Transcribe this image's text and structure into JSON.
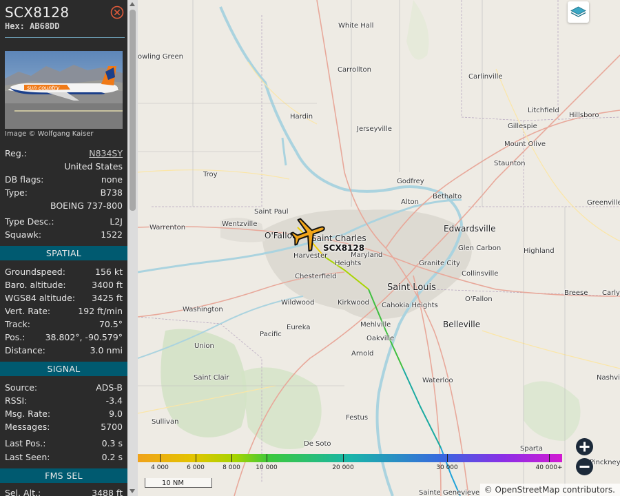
{
  "aircraft": {
    "callsign": "SCX8128",
    "hex_label": "Hex:",
    "hex": "AB68DD",
    "photo_credit": "Image © Wolfgang Kaiser"
  },
  "details": [
    {
      "key": "Reg.:",
      "value": "N834SY",
      "link": true
    },
    {
      "key": "",
      "value": "United States"
    },
    {
      "key": "DB flags:",
      "value": "none"
    },
    {
      "key": "Type:",
      "value": "B738"
    },
    {
      "key": "",
      "value": "BOEING 737-800"
    },
    {
      "key": "Type Desc.:",
      "value": "L2J"
    },
    {
      "key": "Squawk:",
      "value": "1522"
    }
  ],
  "spatial": {
    "title": "SPATIAL",
    "rows": [
      {
        "key": "Groundspeed:",
        "value": "156 kt"
      },
      {
        "key": "Baro. altitude:",
        "value": "3400 ft"
      },
      {
        "key": "WGS84 altitude:",
        "value": "3425 ft"
      },
      {
        "key": "Vert. Rate:",
        "value": "192 ft/min"
      },
      {
        "key": "Track:",
        "value": "70.5°"
      },
      {
        "key": "Pos.:",
        "value": "38.802°, -90.579°"
      },
      {
        "key": "Distance:",
        "value": "3.0 nmi"
      }
    ]
  },
  "signal": {
    "title": "SIGNAL",
    "rows": [
      {
        "key": "Source:",
        "value": "ADS-B"
      },
      {
        "key": "RSSI:",
        "value": "-3.4"
      },
      {
        "key": "Msg. Rate:",
        "value": "9.0"
      },
      {
        "key": "Messages:",
        "value": "5700"
      },
      {
        "key": "Last Pos.:",
        "value": "0.3 s"
      },
      {
        "key": "Last Seen:",
        "value": "0.2 s"
      }
    ]
  },
  "fms": {
    "title": "FMS SEL",
    "rows": [
      {
        "key": "Sel. Alt.:",
        "value": "3488 ft"
      }
    ]
  },
  "map": {
    "aircraft_label": "SCX8128",
    "places": [
      {
        "name": "White Hall",
        "cls": ""
      },
      {
        "name": "owling Green",
        "cls": ""
      },
      {
        "name": "Carrollton",
        "cls": ""
      },
      {
        "name": "Carlinville",
        "cls": ""
      },
      {
        "name": "Hardin",
        "cls": ""
      },
      {
        "name": "Litchfield",
        "cls": ""
      },
      {
        "name": "Hillsboro",
        "cls": ""
      },
      {
        "name": "Jerseyville",
        "cls": ""
      },
      {
        "name": "Gillespie",
        "cls": ""
      },
      {
        "name": "Mount Olive",
        "cls": ""
      },
      {
        "name": "Staunton",
        "cls": ""
      },
      {
        "name": "Troy",
        "cls": ""
      },
      {
        "name": "Godfrey",
        "cls": ""
      },
      {
        "name": "Bethalto",
        "cls": ""
      },
      {
        "name": "Alton",
        "cls": ""
      },
      {
        "name": "Greenville",
        "cls": ""
      },
      {
        "name": "Saint Paul",
        "cls": ""
      },
      {
        "name": "Wentzville",
        "cls": ""
      },
      {
        "name": "Warrenton",
        "cls": ""
      },
      {
        "name": "O'Fallon",
        "cls": "city"
      },
      {
        "name": "Saint Charles",
        "cls": "city"
      },
      {
        "name": "Edwardsville",
        "cls": "city"
      },
      {
        "name": "Maryland",
        "cls": ""
      },
      {
        "name": "Heights",
        "cls": ""
      },
      {
        "name": "Harvester",
        "cls": ""
      },
      {
        "name": "Glen Carbon",
        "cls": ""
      },
      {
        "name": "Highland",
        "cls": ""
      },
      {
        "name": "Granite City",
        "cls": ""
      },
      {
        "name": "Chesterfield",
        "cls": ""
      },
      {
        "name": "Collinsville",
        "cls": ""
      },
      {
        "name": "Saint Louis",
        "cls": "big"
      },
      {
        "name": "Breese",
        "cls": ""
      },
      {
        "name": "Carlyl",
        "cls": ""
      },
      {
        "name": "Wildwood",
        "cls": ""
      },
      {
        "name": "Kirkwood",
        "cls": ""
      },
      {
        "name": "Cahokia Heights",
        "cls": ""
      },
      {
        "name": "O'Fallon",
        "cls": ""
      },
      {
        "name": "Washington",
        "cls": ""
      },
      {
        "name": "Belleville",
        "cls": "city"
      },
      {
        "name": "Mehlville",
        "cls": ""
      },
      {
        "name": "Eureka",
        "cls": ""
      },
      {
        "name": "Pacific",
        "cls": ""
      },
      {
        "name": "Oakville",
        "cls": ""
      },
      {
        "name": "Union",
        "cls": ""
      },
      {
        "name": "Arnold",
        "cls": ""
      },
      {
        "name": "Saint Clair",
        "cls": ""
      },
      {
        "name": "Waterloo",
        "cls": ""
      },
      {
        "name": "Nashvil",
        "cls": ""
      },
      {
        "name": "Festus",
        "cls": ""
      },
      {
        "name": "Sullivan",
        "cls": ""
      },
      {
        "name": "De Soto",
        "cls": ""
      },
      {
        "name": "Sparta",
        "cls": ""
      },
      {
        "name": "Pinckney",
        "cls": ""
      },
      {
        "name": "Sainte Genevieve",
        "cls": ""
      }
    ],
    "altitude_legend": [
      "4 000",
      "6 000",
      "8 000",
      "10 000",
      "20 000",
      "30 000",
      "40 000+"
    ],
    "scale": "10 NM",
    "attribution": {
      "prefix": "© ",
      "link": "OpenStreetMap",
      "suffix": " contributors."
    }
  }
}
